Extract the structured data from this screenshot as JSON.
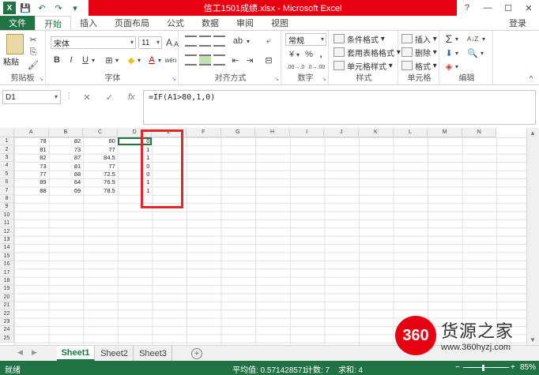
{
  "window": {
    "title": "信工1501成绩.xlsx - Microsoft Excel",
    "app_letter": "X",
    "help": "?",
    "minimize": "—",
    "restore": "☐",
    "close": "✕",
    "login": "登录"
  },
  "quick_access": {
    "save": "💾",
    "undo": "↶",
    "redo": "↷",
    "customize": "▾"
  },
  "tabs": [
    "文件",
    "开始",
    "插入",
    "页面布局",
    "公式",
    "数据",
    "审阅",
    "视图"
  ],
  "active_tab": "开始",
  "ribbon": {
    "clipboard": {
      "label": "剪贴板",
      "paste": "粘贴",
      "cut": "✂",
      "copy": "⎘",
      "painter": "🖌"
    },
    "font": {
      "label": "字体",
      "name": "宋体",
      "size": "11",
      "grow": "A",
      "shrink": "A",
      "bold": "B",
      "italic": "I",
      "underline": "U",
      "underline_dd": "▾",
      "border": "⊞",
      "border_dd": "▾",
      "fill": "◆",
      "fill_dd": "▾",
      "color": "A",
      "color_dd": "▾",
      "phonetic": "wén"
    },
    "alignment": {
      "label": "对齐方式",
      "wrap": "⤶",
      "merge": "⊟",
      "indent_left": "⇤",
      "indent_right": "⇥",
      "orientation": "ab",
      "orientation_dd": "▾"
    },
    "number": {
      "label": "数字",
      "format": "常规",
      "currency": "¥",
      "currency_dd": "▾",
      "percent": "%",
      "comma": ",",
      "inc_decimal": ".00→.0",
      "dec_decimal": ".0→.00"
    },
    "styles": {
      "label": "样式",
      "conditional": "条件格式",
      "table": "套用表格格式",
      "cell": "单元格样式"
    },
    "cells": {
      "label": "单元格",
      "insert": "插入",
      "delete": "删除",
      "format": "格式"
    },
    "editing": {
      "label": "编辑",
      "sum": "Σ",
      "sum_dd": "▾",
      "sort": "A↓Z",
      "fill": "⬇",
      "find": "🔍",
      "clear": "◈",
      "dd": "▾"
    },
    "collapse": "^",
    "launcher": "↘"
  },
  "formula_bar": {
    "name_box": "D1",
    "cancel": "✕",
    "enter": "✓",
    "fx": "fx",
    "formula": "=IF(A1>80,1,0)"
  },
  "columns": [
    "A",
    "B",
    "C",
    "D",
    "E",
    "F",
    "G",
    "H",
    "I",
    "J",
    "K",
    "L",
    "M",
    "N"
  ],
  "rows": [
    "1",
    "2",
    "3",
    "4",
    "5",
    "6",
    "7",
    "8",
    "9",
    "10",
    "11",
    "12",
    "13",
    "14",
    "15",
    "16",
    "17",
    "18",
    "19",
    "20",
    "21",
    "22",
    "23",
    "24",
    "25"
  ],
  "cells": [
    [
      "78",
      "82",
      "80",
      "0"
    ],
    [
      "81",
      "73",
      "77",
      "1"
    ],
    [
      "82",
      "87",
      "84.5",
      "1"
    ],
    [
      "73",
      "81",
      "77",
      "0"
    ],
    [
      "77",
      "68",
      "72.5",
      "0"
    ],
    [
      "89",
      "64",
      "76.5",
      "1"
    ],
    [
      "88",
      "69",
      "78.5",
      "1"
    ]
  ],
  "sheets": [
    "Sheet1",
    "Sheet2",
    "Sheet3"
  ],
  "active_sheet": "Sheet1",
  "sheet_nav": {
    "prev": "◀",
    "next": "▶",
    "add": "+"
  },
  "scroll": {
    "up": "▲",
    "down": "▼"
  },
  "status": {
    "ready": "就绪",
    "average": "平均值: 0.571428571",
    "count": "计数: 7",
    "sum": "求和: 4",
    "zoom": "85%",
    "zoom_minus": "−",
    "zoom_plus": "+"
  },
  "watermark": {
    "logo": "360",
    "name": "货源之家",
    "url": "www.360hyzj.com"
  },
  "colors": {
    "excel_green": "#217346",
    "title_red": "#e60012",
    "highlight_red": "#e0262a"
  }
}
